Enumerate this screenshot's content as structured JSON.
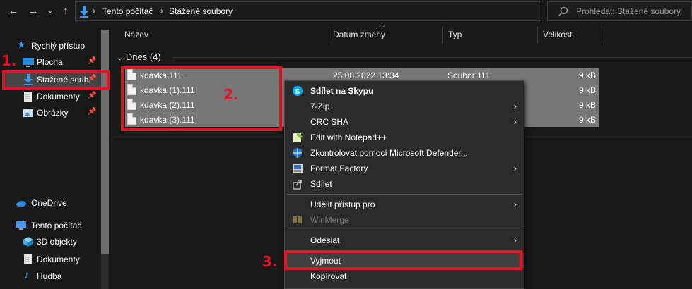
{
  "address": {
    "crumbs": [
      "Tento počítač",
      "Stažené soubory"
    ],
    "search_placeholder": "Prohledat: Stažené soubory"
  },
  "nav": {
    "quick_access": "Rychlý přístup",
    "items": [
      {
        "label": "Plocha",
        "icon": "desktop-icon",
        "pinned": true
      },
      {
        "label": "Stažené soub",
        "icon": "download-icon",
        "pinned": true
      },
      {
        "label": "Dokumenty",
        "icon": "documents-icon",
        "pinned": true
      },
      {
        "label": "Obrázky",
        "icon": "pictures-icon",
        "pinned": true
      }
    ],
    "onedrive": "OneDrive",
    "this_pc": "Tento počítač",
    "pc_items": [
      {
        "label": "3D objekty",
        "icon": "3d-objects-icon"
      },
      {
        "label": "Dokumenty",
        "icon": "documents-icon"
      },
      {
        "label": "Hudba",
        "icon": "music-icon"
      }
    ]
  },
  "columns": {
    "name": "Název",
    "date": "Datum změny",
    "type": "Typ",
    "size": "Velikost"
  },
  "group": {
    "label": "Dnes (4)"
  },
  "files": [
    {
      "name": "kdavka.111",
      "date": "25.08.2022 13:34",
      "type": "Soubor 111",
      "size": "9 kB"
    },
    {
      "name": "kdavka (1).111",
      "date": "",
      "type": "",
      "size": "9 kB"
    },
    {
      "name": "kdavka (2).111",
      "date": "",
      "type": "",
      "size": "9 kB"
    },
    {
      "name": "kdavka (3).111",
      "date": "",
      "type": "",
      "size": "9 kB"
    }
  ],
  "context_menu": {
    "items": [
      {
        "label": "Sdílet na Skypu",
        "icon": "skype-icon",
        "bold": true,
        "submenu": false
      },
      {
        "label": "7-Zip",
        "icon": "",
        "submenu": true
      },
      {
        "label": "CRC SHA",
        "icon": "",
        "submenu": true
      },
      {
        "label": "Edit with Notepad++",
        "icon": "notepad-plus-plus-icon",
        "submenu": false
      },
      {
        "label": "Zkontrolovat pomocí Microsoft Defender...",
        "icon": "defender-icon",
        "submenu": false
      },
      {
        "label": "Format Factory",
        "icon": "format-factory-icon",
        "submenu": true
      },
      {
        "label": "Sdílet",
        "icon": "share-icon",
        "submenu": false
      },
      {
        "label": "Udělit přístup pro",
        "icon": "",
        "submenu": true
      },
      {
        "label": "WinMerge",
        "icon": "winmerge-icon",
        "disabled": true,
        "submenu": false
      },
      {
        "label": "Odeslat",
        "icon": "",
        "submenu": true
      },
      {
        "label": "Vyjmout",
        "icon": "",
        "submenu": false
      },
      {
        "label": "Kopírovat",
        "icon": "",
        "submenu": false
      }
    ]
  },
  "annotations": {
    "one": "1.",
    "two": "2.",
    "three": "3.",
    "color": "#e81123"
  }
}
